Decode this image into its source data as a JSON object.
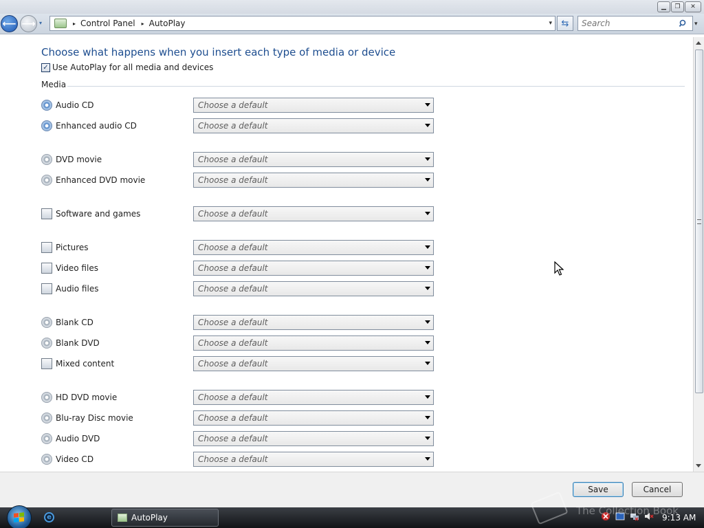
{
  "window": {
    "controls": {
      "minimize": "▁",
      "maximize": "❐",
      "close": "✕"
    }
  },
  "nav": {
    "history_icon": "▾",
    "breadcrumb": [
      "Control Panel",
      "AutoPlay"
    ],
    "crumb_separator": "▸",
    "address_dropdown_icon": "▾",
    "search": {
      "placeholder": "Search"
    },
    "search_dropdown_icon": "▾"
  },
  "content": {
    "heading": "Choose what happens when you insert each type of media or device",
    "use_autoplay": {
      "label": "Use AutoPlay for all media and devices",
      "checked": true,
      "check_glyph": "✓"
    },
    "group_label": "Media",
    "items": [
      {
        "label": "Audio CD",
        "value": "Choose a default",
        "icon": "audio-cd-icon"
      },
      {
        "label": "Enhanced audio CD",
        "value": "Choose a default",
        "icon": "enhanced-audio-cd-icon"
      },
      {
        "label": "DVD movie",
        "value": "Choose a default",
        "icon": "dvd-movie-icon"
      },
      {
        "label": "Enhanced DVD movie",
        "value": "Choose a default",
        "icon": "enhanced-dvd-movie-icon"
      },
      {
        "label": "Software and games",
        "value": "Choose a default",
        "icon": "software-games-icon"
      },
      {
        "label": "Pictures",
        "value": "Choose a default",
        "icon": "pictures-icon"
      },
      {
        "label": "Video files",
        "value": "Choose a default",
        "icon": "video-files-icon"
      },
      {
        "label": "Audio files",
        "value": "Choose a default",
        "icon": "audio-files-icon"
      },
      {
        "label": "Blank CD",
        "value": "Choose a default",
        "icon": "blank-cd-icon"
      },
      {
        "label": "Blank DVD",
        "value": "Choose a default",
        "icon": "blank-dvd-icon"
      },
      {
        "label": "Mixed content",
        "value": "Choose a default",
        "icon": "mixed-content-icon"
      },
      {
        "label": "HD DVD movie",
        "value": "Choose a default",
        "icon": "hd-dvd-movie-icon"
      },
      {
        "label": "Blu-ray Disc movie",
        "value": "Choose a default",
        "icon": "blu-ray-disc-icon"
      },
      {
        "label": "Audio DVD",
        "value": "Choose a default",
        "icon": "audio-dvd-icon"
      },
      {
        "label": "Video CD",
        "value": "Choose a default",
        "icon": "video-cd-icon"
      }
    ]
  },
  "footer": {
    "save_label": "Save",
    "cancel_label": "Cancel"
  },
  "taskbar": {
    "ie_glyph": "e",
    "task_label": "AutoPlay",
    "clock": "9:13 AM",
    "watermark": "The Collection Book"
  },
  "colors": {
    "heading": "#1d4d8f",
    "taskbar": "#111316",
    "accent": "#1d57b3"
  }
}
